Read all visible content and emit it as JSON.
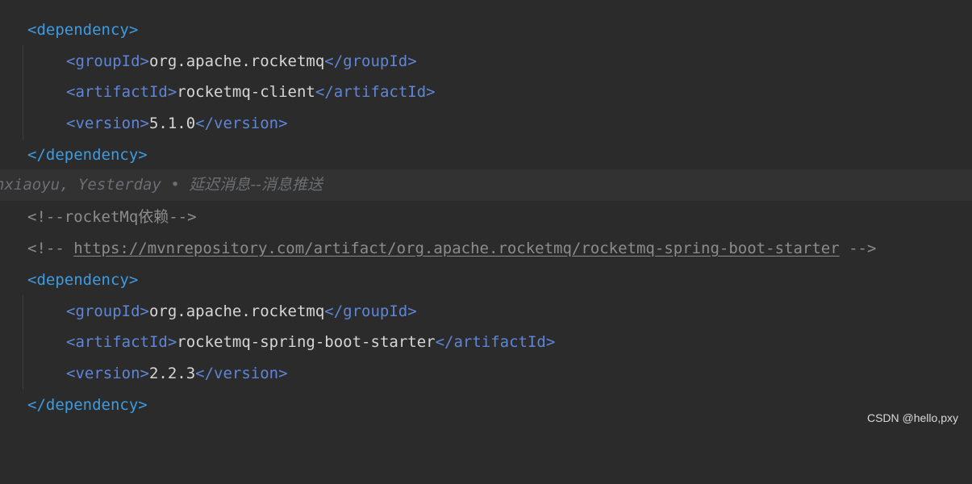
{
  "blame": {
    "author": "nxiaoyu",
    "time": "Yesterday",
    "separator": "•",
    "message": "延迟消息--消息推送"
  },
  "block1": {
    "open": "<dependency>",
    "group_open": "<groupId>",
    "group_value": "org.apache.rocketmq",
    "group_close": "</groupId>",
    "artifact_open": "<artifactId>",
    "artifact_value": "rocketmq-client",
    "artifact_close": "</artifactId>",
    "version_open": "<version>",
    "version_value": "5.1.0",
    "version_close": "</version>",
    "close": "</dependency>"
  },
  "comment1": "<!--rocketMq依赖-->",
  "comment2": {
    "start": "<!-- ",
    "url": "https://mvnrepository.com/artifact/org.apache.rocketmq/rocketmq-spring-boot-starter",
    "end": " -->"
  },
  "block2": {
    "open": "<dependency>",
    "group_open": "<groupId>",
    "group_value": "org.apache.rocketmq",
    "group_close": "</groupId>",
    "artifact_open": "<artifactId>",
    "artifact_value": "rocketmq-spring-boot-starter",
    "artifact_close": "</artifactId>",
    "version_open": "<version>",
    "version_value": "2.2.3",
    "version_close": "</version>",
    "close": "</dependency>"
  },
  "watermark": "CSDN @hello,pxy"
}
